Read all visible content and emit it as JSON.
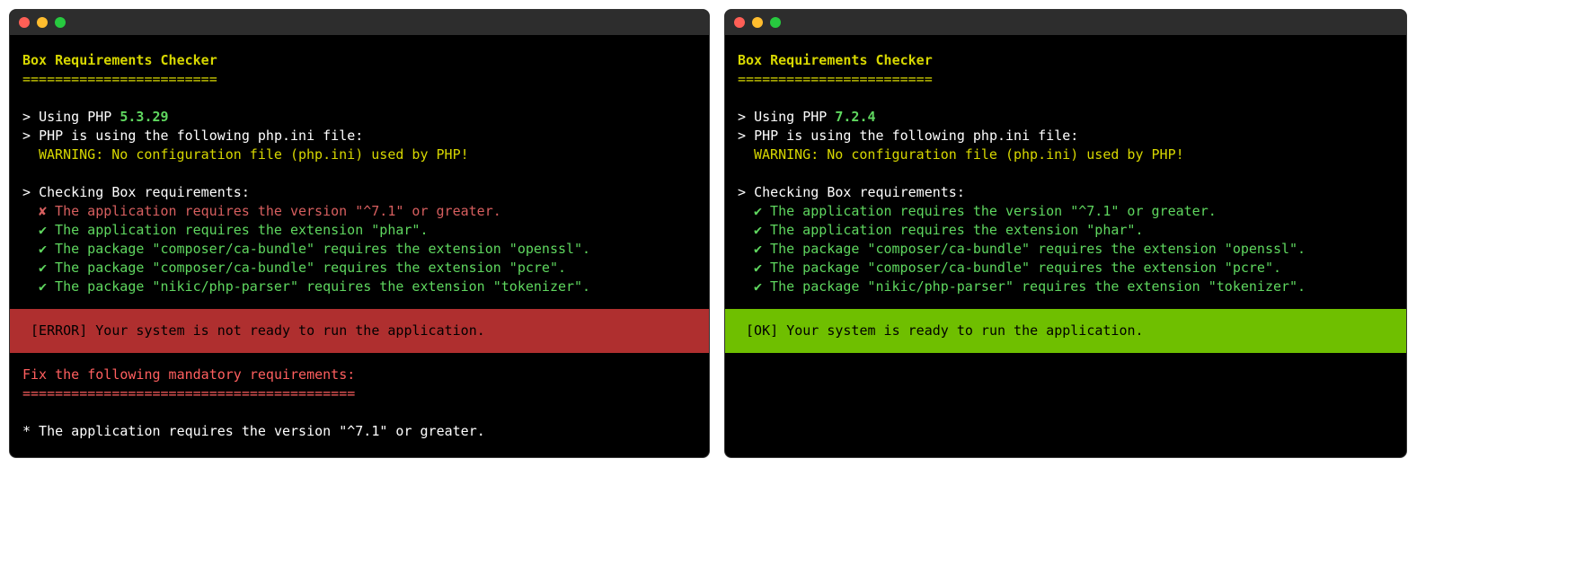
{
  "left": {
    "title": "Box Requirements Checker",
    "underline": "========================",
    "using_php_label": "Using PHP",
    "php_version": "5.3.29",
    "php_ini_line": "PHP is using the following php.ini file:",
    "warning": "WARNING: No configuration file (php.ini) used by PHP!",
    "checking": "Checking Box requirements:",
    "checks": [
      {
        "ok": false,
        "text": "The application requires the version \"^7.1\" or greater."
      },
      {
        "ok": true,
        "text": "The application requires the extension \"phar\"."
      },
      {
        "ok": true,
        "text": "The package \"composer/ca-bundle\" requires the extension \"openssl\"."
      },
      {
        "ok": true,
        "text": "The package \"composer/ca-bundle\" requires the extension \"pcre\"."
      },
      {
        "ok": true,
        "text": "The package \"nikic/php-parser\" requires the extension \"tokenizer\"."
      }
    ],
    "status_label": "[ERROR]",
    "status_text": "Your system is not ready to run the application.",
    "fix_header": "Fix the following mandatory requirements:",
    "fix_underline": "=========================================",
    "fix_items": [
      "* The application requires the version \"^7.1\" or greater."
    ]
  },
  "right": {
    "title": "Box Requirements Checker",
    "underline": "========================",
    "using_php_label": "Using PHP",
    "php_version": "7.2.4",
    "php_ini_line": "PHP is using the following php.ini file:",
    "warning": "WARNING: No configuration file (php.ini) used by PHP!",
    "checking": "Checking Box requirements:",
    "checks": [
      {
        "ok": true,
        "text": "The application requires the version \"^7.1\" or greater."
      },
      {
        "ok": true,
        "text": "The application requires the extension \"phar\"."
      },
      {
        "ok": true,
        "text": "The package \"composer/ca-bundle\" requires the extension \"openssl\"."
      },
      {
        "ok": true,
        "text": "The package \"composer/ca-bundle\" requires the extension \"pcre\"."
      },
      {
        "ok": true,
        "text": "The package \"nikic/php-parser\" requires the extension \"tokenizer\"."
      }
    ],
    "status_label": "[OK]",
    "status_text": "Your system is ready to run the application."
  },
  "glyphs": {
    "prompt": ">",
    "check": "✔",
    "cross": "✘"
  }
}
